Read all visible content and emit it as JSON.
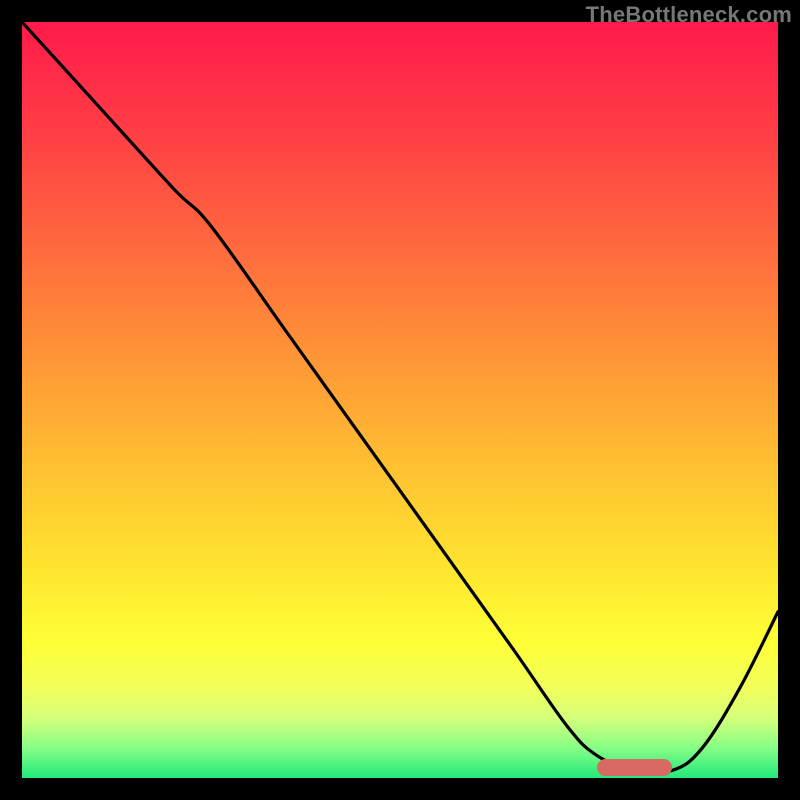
{
  "watermark": "TheBottleneck.com",
  "colors": {
    "curve_stroke": "#000000",
    "segment_fill": "#d96a63",
    "gradient_top": "#ff1a4b",
    "gradient_bottom": "#23e77a"
  },
  "chart_data": {
    "type": "line",
    "title": "",
    "xlabel": "",
    "ylabel": "",
    "xlim": [
      0,
      100
    ],
    "ylim": [
      0,
      100
    ],
    "grid": false,
    "series": [
      {
        "name": "bottleneck-curve",
        "x": [
          0,
          10,
          20,
          25,
          35,
          45,
          55,
          65,
          72,
          76,
          81,
          86,
          90,
          95,
          100
        ],
        "values": [
          100,
          89,
          78,
          73,
          59,
          45,
          31,
          17,
          7,
          3,
          1,
          1,
          4,
          12,
          22
        ]
      }
    ],
    "annotations": [
      {
        "name": "highlighted-range-segment",
        "shape": "rounded-bar",
        "x_start": 76,
        "x_end": 86,
        "y": 1.5,
        "color": "#d96a63"
      }
    ]
  }
}
